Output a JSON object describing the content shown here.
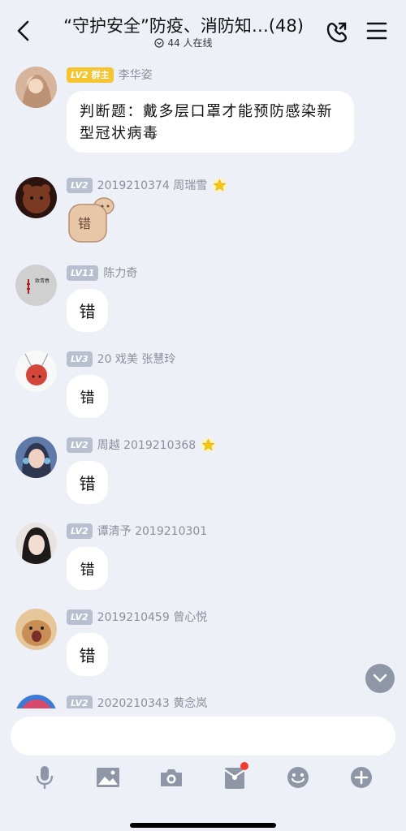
{
  "header": {
    "title": "“守护安全”防疫、消防知…(48)",
    "online": "44 人在线"
  },
  "messages": [
    {
      "level": "LV2",
      "role": "群主",
      "name": "李华姿",
      "text": "判断题：戴多层口罩才能预防感染新型冠状病毒",
      "avatar_color": "#c9a58a"
    },
    {
      "level": "LV2",
      "name": "2019210374 周瑞雪",
      "starred": true,
      "sticker_text": "错",
      "avatar_color": "#5a2b1e"
    },
    {
      "level": "LV11",
      "name": "陈力奇",
      "text": "错",
      "avatar_color": "#c4c4c4"
    },
    {
      "level": "LV3",
      "name": "20 戏美 张慧玲",
      "text": "错",
      "avatar_color": "#f4f4f4"
    },
    {
      "level": "LV2",
      "name": "周越 2019210368",
      "starred": true,
      "text": "错",
      "avatar_color": "#6a7fa8"
    },
    {
      "level": "LV2",
      "name": "谭清予 2019210301",
      "text": "错",
      "avatar_color": "#3a3a3a"
    },
    {
      "level": "LV2",
      "name": "2019210459 曾心悦",
      "text": "错",
      "avatar_color": "#b9875a"
    },
    {
      "level": "LV2",
      "name": "2020210343 黄念岚",
      "avatar_color": "#d84a6b"
    }
  ],
  "input": {
    "placeholder": ""
  },
  "toolbar": [
    "voice-icon",
    "image-icon",
    "camera-icon",
    "red-packet-icon",
    "emoji-icon",
    "plus-icon"
  ],
  "colors": {
    "background": "#eef0f8",
    "level_badge": "#b8bfcf",
    "owner_badge": "#f4c531",
    "badge_dot": "#f33b2d"
  }
}
